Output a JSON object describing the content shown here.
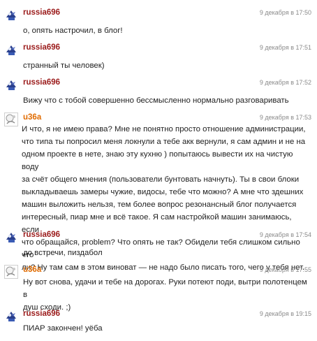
{
  "comments": [
    {
      "author": "russia696",
      "author_color": "#9b1b1b",
      "avatar": "bird-avatar",
      "time": "9 декабря в 17:50",
      "text": "о, опять настрочил, в блог!"
    },
    {
      "author": "russia696",
      "author_color": "#9b1b1b",
      "avatar": "bird-avatar",
      "time": "9 декабря в 17:51",
      "text": "странный ты человек)"
    },
    {
      "author": "russia696",
      "author_color": "#9b1b1b",
      "avatar": "bird-avatar",
      "time": "9 декабря в 17:52",
      "text": "Вижу что с тобой совершенно бессмысленно нормально разговаривать"
    },
    {
      "author": "u36a",
      "author_color": "#e06b00",
      "avatar": "sticker-avatar",
      "time": "9 декабря в 17:53",
      "text": " И что, я не имею права? Мне не понятно просто отношение администрации,\nчто типа ты попросил меня локнули а тебе акк вернули, я сам админ и не на\nодном проекте в нете, знаю эту кухню ) попытаюсь вывести их на чистую воду\nза счёт общего мнения (пользователи бунтовать начнуть). Ты в свои блоки\nвыкладываешь замеры чужие, видосы, тебе что можно? А мне что здешних\nмашин выложить нельзя, тем более вопрос резонансный блог получается\nинтересный, пиар мне и всё такое. Я сам настройкой машин занимаюсь, если\nчто обращайся, problem? Что опять не так? Обидели тебя слишком сильно что\nли? Ну там сам в этом виноват — не надо было писать того, чего у тебя нет."
    },
    {
      "author": "russia696",
      "author_color": "#9b1b1b",
      "avatar": "bird-avatar",
      "time": "9 декабря в 17:54",
      "text": "до встречи, пиздабол"
    },
    {
      "author": "u36a",
      "author_color": "#e06b00",
      "avatar": "sticker-avatar",
      "time": "9 декабря в 17:55",
      "text": "Ну вот снова, удачи и тебе на дорогах. Руки потеют поди, вытри полотенцем в\nдуш сходи. ;)"
    },
    {
      "author": "russia696",
      "author_color": "#9b1b1b",
      "avatar": "bird-avatar",
      "time": "9 декабря в 19:15",
      "text": "ПИАР закончен! уёба"
    }
  ]
}
